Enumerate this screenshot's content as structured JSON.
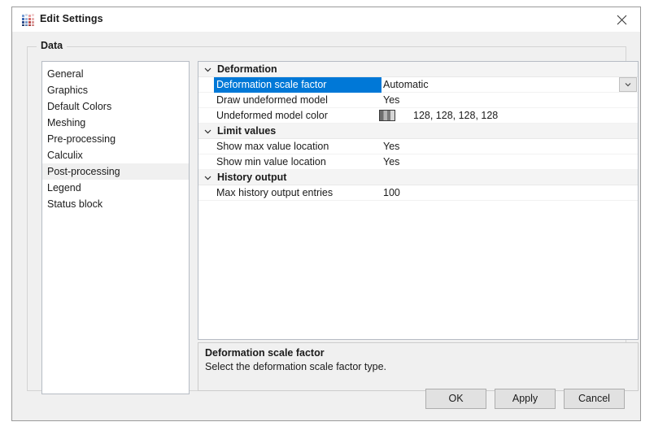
{
  "window": {
    "title": "Edit Settings",
    "icon": "app-grid-icon",
    "close_icon": "close-icon"
  },
  "groupbox": {
    "label": "Data"
  },
  "categories": {
    "items": [
      {
        "label": "General",
        "selected": false
      },
      {
        "label": "Graphics",
        "selected": false
      },
      {
        "label": "Default Colors",
        "selected": false
      },
      {
        "label": "Meshing",
        "selected": false
      },
      {
        "label": "Pre-processing",
        "selected": false
      },
      {
        "label": "Calculix",
        "selected": false
      },
      {
        "label": "Post-processing",
        "selected": true
      },
      {
        "label": "Legend",
        "selected": false
      },
      {
        "label": "Status block",
        "selected": false
      }
    ]
  },
  "properties": {
    "groups": [
      {
        "name": "Deformation",
        "expanded": true,
        "chevron_icon": "chevron-down-icon",
        "rows": [
          {
            "name": "Deformation scale factor",
            "value": "Automatic",
            "selected": true,
            "editor": "combobox",
            "combo_icon": "chevron-down-icon"
          },
          {
            "name": "Draw undeformed model",
            "value": "Yes",
            "selected": false,
            "editor": "text"
          },
          {
            "name": "Undeformed model color",
            "value": "128, 128, 128, 128",
            "selected": false,
            "editor": "color",
            "swatch_icon": "color-swatch-icon"
          }
        ]
      },
      {
        "name": "Limit values",
        "expanded": true,
        "chevron_icon": "chevron-down-icon",
        "rows": [
          {
            "name": "Show max value location",
            "value": "Yes",
            "selected": false,
            "editor": "text"
          },
          {
            "name": "Show min value location",
            "value": "Yes",
            "selected": false,
            "editor": "text"
          }
        ]
      },
      {
        "name": "History output",
        "expanded": true,
        "chevron_icon": "chevron-down-icon",
        "rows": [
          {
            "name": "Max history output entries",
            "value": "100",
            "selected": false,
            "editor": "text"
          }
        ]
      }
    ]
  },
  "description": {
    "title": "Deformation scale factor",
    "text": "Select the deformation scale factor type."
  },
  "footer": {
    "buttons": [
      {
        "id": "btn-ok",
        "label": "OK"
      },
      {
        "id": "btn-apply",
        "label": "Apply"
      },
      {
        "id": "btn-cancel",
        "label": "Cancel"
      }
    ]
  },
  "colors": {
    "selection_blue": "#0078d7",
    "dialog_bg": "#f0f0f0",
    "titlebar_bg": "#ffffff",
    "list_highlight": "#f0f0f0",
    "text": "#1b1b1b"
  }
}
